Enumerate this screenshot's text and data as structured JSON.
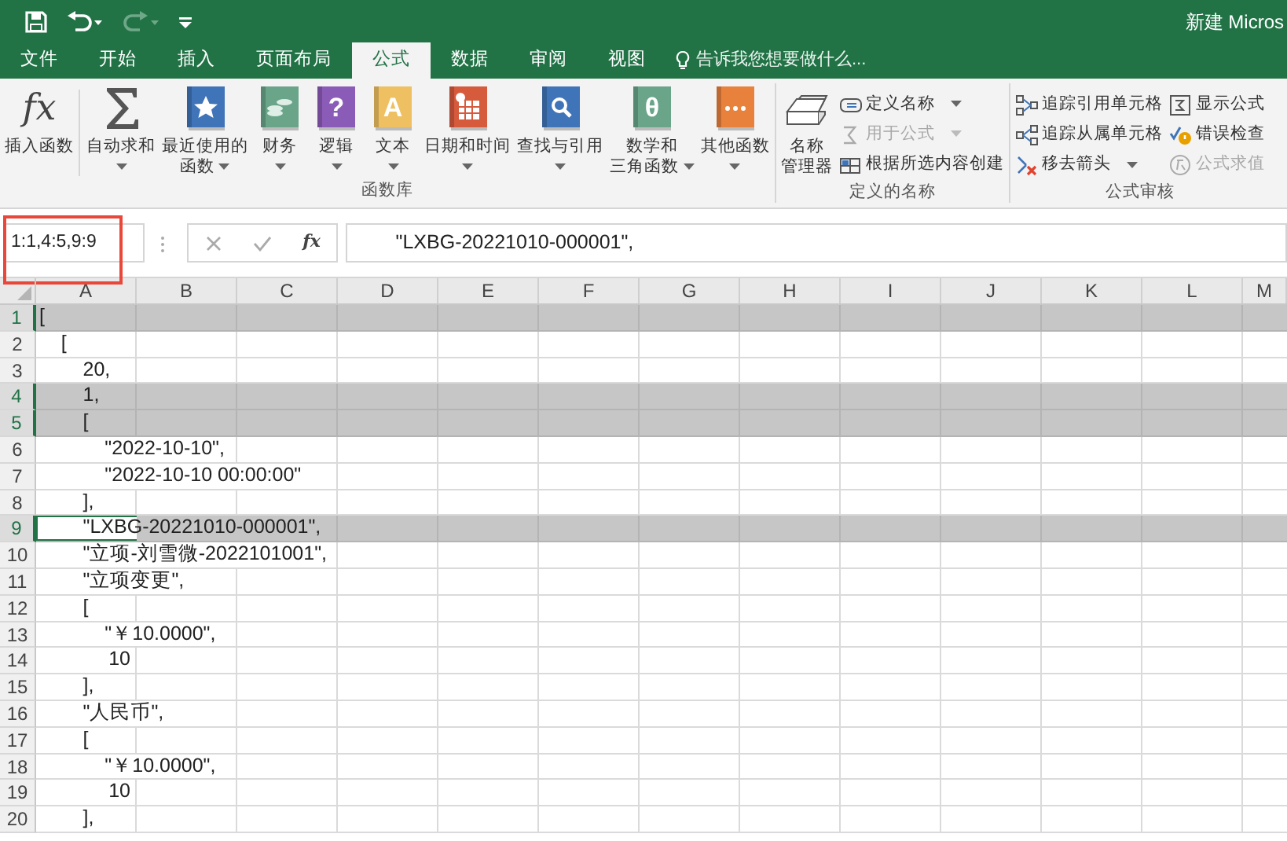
{
  "title_bar": {
    "quick_access": [
      {
        "kind": "save",
        "disabled": false
      },
      {
        "kind": "undo",
        "disabled": false
      },
      {
        "kind": "redo",
        "disabled": true
      },
      {
        "kind": "customize",
        "disabled": false
      }
    ],
    "title": "新建 Micros"
  },
  "tabs": [
    {
      "label": "文件",
      "selected": false
    },
    {
      "label": "开始",
      "selected": false
    },
    {
      "label": "插入",
      "selected": false
    },
    {
      "label": "页面布局",
      "selected": false
    },
    {
      "label": "公式",
      "selected": true
    },
    {
      "label": "数据",
      "selected": false
    },
    {
      "label": "审阅",
      "selected": false
    },
    {
      "label": "视图",
      "selected": false
    }
  ],
  "tell_me": {
    "placeholder": "告诉我您想要做什么..."
  },
  "ribbon": {
    "groups": [
      {
        "label": "函数库",
        "buttons": [
          {
            "kind": "glyph",
            "glyph": "fx",
            "lines": [
              "插入函数"
            ],
            "dropdown": false
          },
          {
            "kind": "sigma",
            "lines": [
              "自动求和"
            ],
            "dropdown": true
          },
          {
            "kind": "star_book",
            "color": "#3f74b8",
            "lines": [
              "最近使用的",
              "函数"
            ],
            "dropdown": true
          },
          {
            "kind": "coins_book",
            "color": "#6aa58a",
            "lines": [
              "财务"
            ],
            "dropdown": true
          },
          {
            "kind": "glyph_book",
            "color": "#8b5bb8",
            "glyph": "?",
            "lines": [
              "逻辑"
            ],
            "dropdown": true
          },
          {
            "kind": "glyph_book",
            "color": "#eec061",
            "glyph": "A",
            "lines": [
              "文本"
            ],
            "dropdown": true
          },
          {
            "kind": "calendar_book",
            "color": "#d65a3c",
            "lines": [
              "日期和时间"
            ],
            "dropdown": true
          },
          {
            "kind": "magnifier_book",
            "color": "#3f74b8",
            "lines": [
              "查找与引用"
            ],
            "dropdown": true
          },
          {
            "kind": "glyph_book",
            "color": "#6aa58a",
            "glyph": "θ",
            "lines": [
              "数学和",
              "三角函数"
            ],
            "dropdown": true
          },
          {
            "kind": "dots_book",
            "color": "#e8813c",
            "lines": [
              "其他函数"
            ],
            "dropdown": true
          }
        ]
      },
      {
        "label": "定义的名称",
        "buttons": [
          {
            "kind": "name_manager",
            "lines": [
              "名称",
              "管理器"
            ],
            "dropdown": false
          }
        ],
        "small_columns": [
          [
            {
              "kind": "tag",
              "label": "定义名称",
              "dropdown": true,
              "disabled": false
            },
            {
              "kind": "use_formula",
              "label": "用于公式",
              "dropdown": true,
              "disabled": true
            },
            {
              "kind": "create_from_selection",
              "label": "根据所选内容创建",
              "dropdown": false,
              "disabled": false
            }
          ]
        ]
      },
      {
        "label": "公式审核",
        "small_columns": [
          [
            {
              "kind": "trace_precedents",
              "label": "追踪引用单元格",
              "dropdown": false,
              "disabled": false
            },
            {
              "kind": "trace_dependents",
              "label": "追踪从属单元格",
              "dropdown": false,
              "disabled": false
            },
            {
              "kind": "remove_arrows",
              "label": "移去箭头",
              "dropdown": true,
              "disabled": false
            }
          ],
          [
            {
              "kind": "show_formulas",
              "label": "显示公式",
              "dropdown": false,
              "disabled": false
            },
            {
              "kind": "error_checking",
              "label": "错误检查",
              "dropdown": false,
              "disabled": false
            },
            {
              "kind": "evaluate",
              "label": "公式求值",
              "dropdown": false,
              "disabled": true
            }
          ]
        ]
      }
    ]
  },
  "formula_bar": {
    "name_box": "1:1,4:5,9:9",
    "name_box_annotated": true,
    "buttons": [
      {
        "kind": "cancel"
      },
      {
        "kind": "enter"
      },
      {
        "kind": "function",
        "glyph": "fx"
      }
    ],
    "formula": "        \"LXBG-20221010-000001\","
  },
  "sheet": {
    "columns": [
      "A",
      "B",
      "C",
      "D",
      "E",
      "F",
      "G",
      "H",
      "I",
      "J",
      "K",
      "L",
      "M"
    ],
    "rows": [
      {
        "number": "1",
        "selected": true,
        "active": false,
        "kind": "text",
        "text": "["
      },
      {
        "number": "2",
        "selected": false,
        "active": false,
        "kind": "text",
        "text": "    ["
      },
      {
        "number": "3",
        "selected": false,
        "active": false,
        "kind": "text",
        "text": "        20,"
      },
      {
        "number": "4",
        "selected": true,
        "active": false,
        "kind": "text",
        "text": "        1,"
      },
      {
        "number": "5",
        "selected": true,
        "active": false,
        "kind": "text",
        "text": "        ["
      },
      {
        "number": "6",
        "selected": false,
        "active": false,
        "kind": "text",
        "text": "            \"2022-10-10\","
      },
      {
        "number": "7",
        "selected": false,
        "active": false,
        "kind": "text",
        "text": "            \"2022-10-10 00:00:00\""
      },
      {
        "number": "8",
        "selected": false,
        "active": false,
        "kind": "text",
        "text": "        ],"
      },
      {
        "number": "9",
        "selected": true,
        "active": true,
        "kind": "text",
        "text": "        \"LXBG-20221010-000001\","
      },
      {
        "number": "10",
        "selected": false,
        "active": false,
        "kind": "text",
        "text": "        \"立项-刘雪微-2022101001\","
      },
      {
        "number": "11",
        "selected": false,
        "active": false,
        "kind": "text",
        "text": "        \"立项变更\","
      },
      {
        "number": "12",
        "selected": false,
        "active": false,
        "kind": "text",
        "text": "        ["
      },
      {
        "number": "13",
        "selected": false,
        "active": false,
        "kind": "text",
        "text": "            \"￥10.0000\","
      },
      {
        "number": "14",
        "selected": false,
        "active": false,
        "kind": "number",
        "text": "10"
      },
      {
        "number": "15",
        "selected": false,
        "active": false,
        "kind": "text",
        "text": "        ],"
      },
      {
        "number": "16",
        "selected": false,
        "active": false,
        "kind": "text",
        "text": "        \"人民币\","
      },
      {
        "number": "17",
        "selected": false,
        "active": false,
        "kind": "text",
        "text": "        ["
      },
      {
        "number": "18",
        "selected": false,
        "active": false,
        "kind": "text",
        "text": "            \"￥10.0000\","
      },
      {
        "number": "19",
        "selected": false,
        "active": false,
        "kind": "number",
        "text": "10"
      },
      {
        "number": "20",
        "selected": false,
        "active": false,
        "kind": "text",
        "text": "        ],"
      }
    ]
  }
}
